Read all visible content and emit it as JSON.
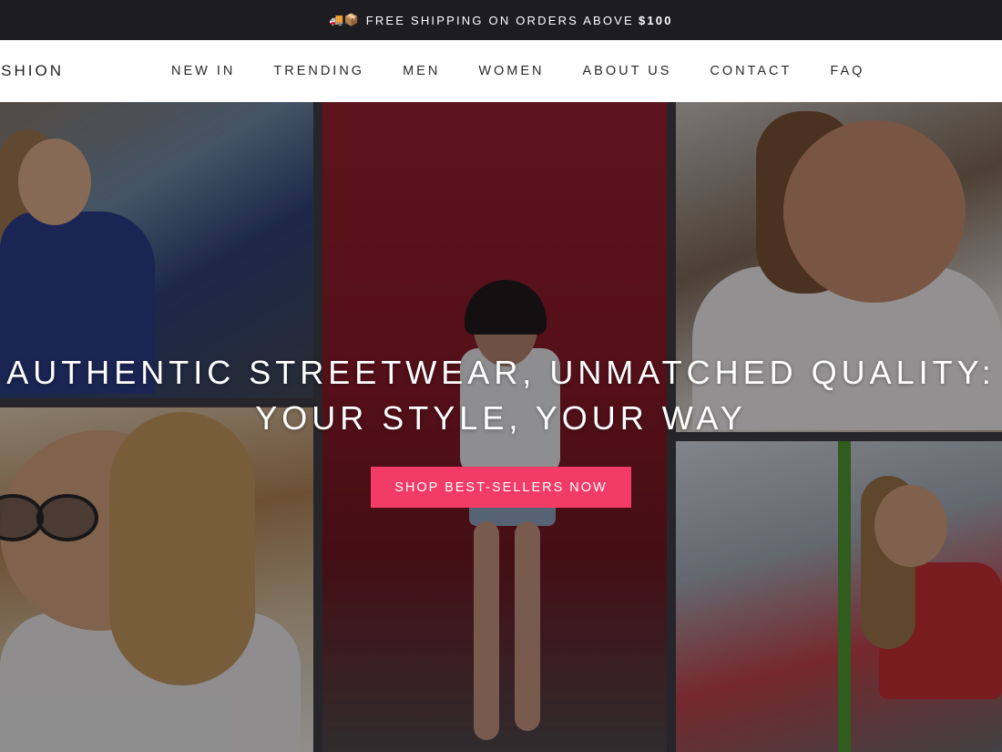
{
  "announcement": {
    "emoji": "🚚📦",
    "text": "FREE SHIPPING ON ORDERS ABOVE",
    "amount": "$100"
  },
  "header": {
    "logo_text": "FASHION",
    "menu": [
      "NEW IN",
      "TRENDING",
      "MEN",
      "WOMEN",
      "ABOUT US",
      "CONTACT",
      "FAQ"
    ]
  },
  "hero": {
    "headline_line1": "AUTHENTIC STREETWEAR, UNMATCHED QUALITY:",
    "headline_line2": "YOUR STYLE, YOUR WAY",
    "cta_label": "SHOP BEST-SELLERS NOW",
    "cta_color": "#f23b66"
  }
}
